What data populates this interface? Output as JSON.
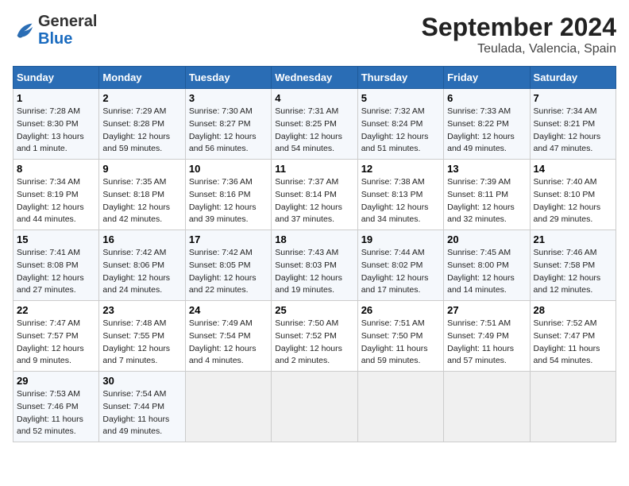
{
  "logo": {
    "general": "General",
    "blue": "Blue"
  },
  "title": "September 2024",
  "subtitle": "Teulada, Valencia, Spain",
  "headers": [
    "Sunday",
    "Monday",
    "Tuesday",
    "Wednesday",
    "Thursday",
    "Friday",
    "Saturday"
  ],
  "weeks": [
    [
      {
        "num": "1",
        "sunrise": "Sunrise: 7:28 AM",
        "sunset": "Sunset: 8:30 PM",
        "daylight": "Daylight: 13 hours and 1 minute."
      },
      {
        "num": "2",
        "sunrise": "Sunrise: 7:29 AM",
        "sunset": "Sunset: 8:28 PM",
        "daylight": "Daylight: 12 hours and 59 minutes."
      },
      {
        "num": "3",
        "sunrise": "Sunrise: 7:30 AM",
        "sunset": "Sunset: 8:27 PM",
        "daylight": "Daylight: 12 hours and 56 minutes."
      },
      {
        "num": "4",
        "sunrise": "Sunrise: 7:31 AM",
        "sunset": "Sunset: 8:25 PM",
        "daylight": "Daylight: 12 hours and 54 minutes."
      },
      {
        "num": "5",
        "sunrise": "Sunrise: 7:32 AM",
        "sunset": "Sunset: 8:24 PM",
        "daylight": "Daylight: 12 hours and 51 minutes."
      },
      {
        "num": "6",
        "sunrise": "Sunrise: 7:33 AM",
        "sunset": "Sunset: 8:22 PM",
        "daylight": "Daylight: 12 hours and 49 minutes."
      },
      {
        "num": "7",
        "sunrise": "Sunrise: 7:34 AM",
        "sunset": "Sunset: 8:21 PM",
        "daylight": "Daylight: 12 hours and 47 minutes."
      }
    ],
    [
      {
        "num": "8",
        "sunrise": "Sunrise: 7:34 AM",
        "sunset": "Sunset: 8:19 PM",
        "daylight": "Daylight: 12 hours and 44 minutes."
      },
      {
        "num": "9",
        "sunrise": "Sunrise: 7:35 AM",
        "sunset": "Sunset: 8:18 PM",
        "daylight": "Daylight: 12 hours and 42 minutes."
      },
      {
        "num": "10",
        "sunrise": "Sunrise: 7:36 AM",
        "sunset": "Sunset: 8:16 PM",
        "daylight": "Daylight: 12 hours and 39 minutes."
      },
      {
        "num": "11",
        "sunrise": "Sunrise: 7:37 AM",
        "sunset": "Sunset: 8:14 PM",
        "daylight": "Daylight: 12 hours and 37 minutes."
      },
      {
        "num": "12",
        "sunrise": "Sunrise: 7:38 AM",
        "sunset": "Sunset: 8:13 PM",
        "daylight": "Daylight: 12 hours and 34 minutes."
      },
      {
        "num": "13",
        "sunrise": "Sunrise: 7:39 AM",
        "sunset": "Sunset: 8:11 PM",
        "daylight": "Daylight: 12 hours and 32 minutes."
      },
      {
        "num": "14",
        "sunrise": "Sunrise: 7:40 AM",
        "sunset": "Sunset: 8:10 PM",
        "daylight": "Daylight: 12 hours and 29 minutes."
      }
    ],
    [
      {
        "num": "15",
        "sunrise": "Sunrise: 7:41 AM",
        "sunset": "Sunset: 8:08 PM",
        "daylight": "Daylight: 12 hours and 27 minutes."
      },
      {
        "num": "16",
        "sunrise": "Sunrise: 7:42 AM",
        "sunset": "Sunset: 8:06 PM",
        "daylight": "Daylight: 12 hours and 24 minutes."
      },
      {
        "num": "17",
        "sunrise": "Sunrise: 7:42 AM",
        "sunset": "Sunset: 8:05 PM",
        "daylight": "Daylight: 12 hours and 22 minutes."
      },
      {
        "num": "18",
        "sunrise": "Sunrise: 7:43 AM",
        "sunset": "Sunset: 8:03 PM",
        "daylight": "Daylight: 12 hours and 19 minutes."
      },
      {
        "num": "19",
        "sunrise": "Sunrise: 7:44 AM",
        "sunset": "Sunset: 8:02 PM",
        "daylight": "Daylight: 12 hours and 17 minutes."
      },
      {
        "num": "20",
        "sunrise": "Sunrise: 7:45 AM",
        "sunset": "Sunset: 8:00 PM",
        "daylight": "Daylight: 12 hours and 14 minutes."
      },
      {
        "num": "21",
        "sunrise": "Sunrise: 7:46 AM",
        "sunset": "Sunset: 7:58 PM",
        "daylight": "Daylight: 12 hours and 12 minutes."
      }
    ],
    [
      {
        "num": "22",
        "sunrise": "Sunrise: 7:47 AM",
        "sunset": "Sunset: 7:57 PM",
        "daylight": "Daylight: 12 hours and 9 minutes."
      },
      {
        "num": "23",
        "sunrise": "Sunrise: 7:48 AM",
        "sunset": "Sunset: 7:55 PM",
        "daylight": "Daylight: 12 hours and 7 minutes."
      },
      {
        "num": "24",
        "sunrise": "Sunrise: 7:49 AM",
        "sunset": "Sunset: 7:54 PM",
        "daylight": "Daylight: 12 hours and 4 minutes."
      },
      {
        "num": "25",
        "sunrise": "Sunrise: 7:50 AM",
        "sunset": "Sunset: 7:52 PM",
        "daylight": "Daylight: 12 hours and 2 minutes."
      },
      {
        "num": "26",
        "sunrise": "Sunrise: 7:51 AM",
        "sunset": "Sunset: 7:50 PM",
        "daylight": "Daylight: 11 hours and 59 minutes."
      },
      {
        "num": "27",
        "sunrise": "Sunrise: 7:51 AM",
        "sunset": "Sunset: 7:49 PM",
        "daylight": "Daylight: 11 hours and 57 minutes."
      },
      {
        "num": "28",
        "sunrise": "Sunrise: 7:52 AM",
        "sunset": "Sunset: 7:47 PM",
        "daylight": "Daylight: 11 hours and 54 minutes."
      }
    ],
    [
      {
        "num": "29",
        "sunrise": "Sunrise: 7:53 AM",
        "sunset": "Sunset: 7:46 PM",
        "daylight": "Daylight: 11 hours and 52 minutes."
      },
      {
        "num": "30",
        "sunrise": "Sunrise: 7:54 AM",
        "sunset": "Sunset: 7:44 PM",
        "daylight": "Daylight: 11 hours and 49 minutes."
      },
      null,
      null,
      null,
      null,
      null
    ]
  ]
}
